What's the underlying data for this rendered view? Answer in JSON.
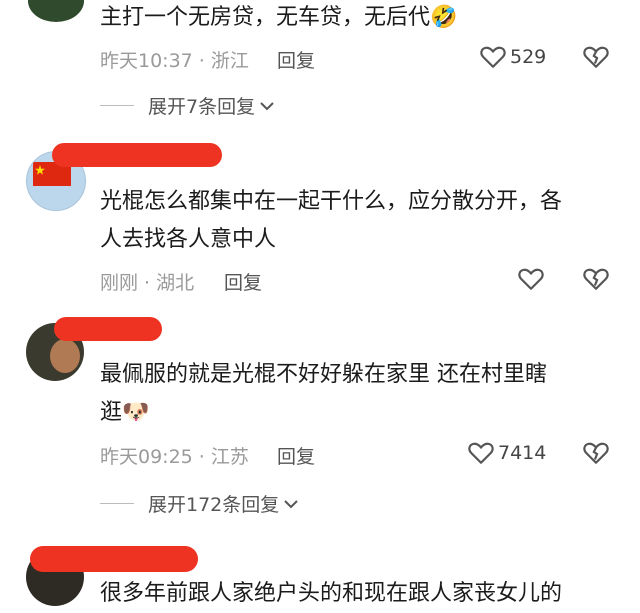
{
  "comments": [
    {
      "text": "主打一个无房贷，无车贷，无后代",
      "emoji": "🤣",
      "time_location": "昨天10:37 · 浙江",
      "reply": "回复",
      "likes": "529",
      "expand": "展开7条回复"
    },
    {
      "text_line1": "光棍怎么都集中在一起干什么，应分散分开，各",
      "text_line2": "人去找各人意中人",
      "time_location": "刚刚 · 湖北",
      "reply": "回复"
    },
    {
      "text_line1": "最佩服的就是光棍不好好躲在家里 还在村里瞎",
      "text_line2": "逛",
      "emoji": "🐶",
      "time_location": "昨天09:25 · 江苏",
      "reply": "回复",
      "likes": "7414",
      "expand": "展开172条回复"
    },
    {
      "text_partial": "很多年前跟人家绝户头的和现在跟人家丧女儿的"
    }
  ],
  "colors": {
    "redaction": "#ee3322",
    "meta_text": "#9a9a9a"
  }
}
